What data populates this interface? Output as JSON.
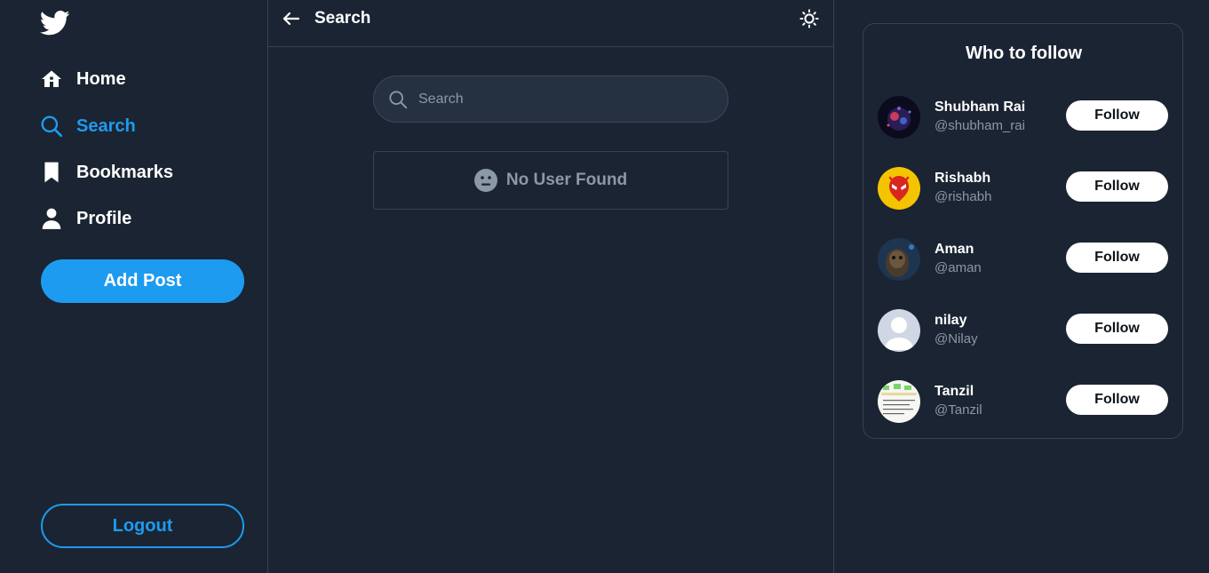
{
  "sidebar": {
    "logo_icon": "twitter-bird-icon",
    "nav": {
      "home": {
        "label": "Home",
        "icon": "home-icon"
      },
      "search": {
        "label": "Search",
        "icon": "search-icon"
      },
      "bookmarks": {
        "label": "Bookmarks",
        "icon": "bookmark-icon"
      },
      "profile": {
        "label": "Profile",
        "icon": "user-icon"
      }
    },
    "active_item": "search",
    "add_post_label": "Add Post",
    "logout_label": "Logout"
  },
  "main": {
    "title": "Search",
    "back_icon": "arrow-left-icon",
    "theme_icon": "sun-icon",
    "search": {
      "placeholder": "Search",
      "value": ""
    },
    "empty_state": {
      "icon": "neutral-face-icon",
      "text": "No User Found"
    }
  },
  "who_to_follow": {
    "title": "Who to follow",
    "follow_label": "Follow",
    "users": [
      {
        "name": "Shubham Rai",
        "handle": "@shubham_rai"
      },
      {
        "name": "Rishabh",
        "handle": "@rishabh"
      },
      {
        "name": "Aman",
        "handle": "@aman"
      },
      {
        "name": "nilay",
        "handle": "@Nilay"
      },
      {
        "name": "Tanzil",
        "handle": "@Tanzil"
      }
    ]
  },
  "colors": {
    "background": "#1b2432",
    "accent": "#1d9bf0",
    "border": "#38444d",
    "muted_text": "#8b98a5"
  }
}
